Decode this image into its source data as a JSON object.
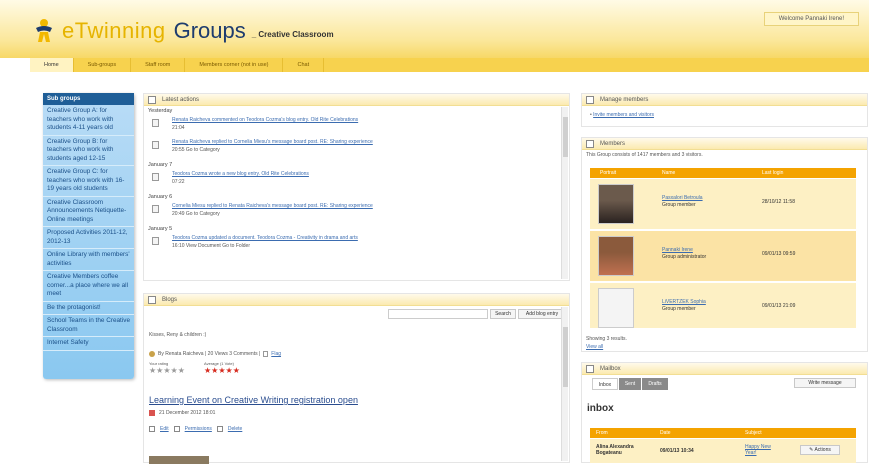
{
  "header": {
    "logo_text": "eTwinning",
    "logo_groups": "Groups",
    "logo_sub": "_ Creative Classroom",
    "welcome": "Welcome Pannaki Irene!"
  },
  "nav": [
    "Home",
    "Sub-groups",
    "Staff room",
    "Members corner (not in use)",
    "Chat"
  ],
  "sidebar": {
    "heading": "Sub groups",
    "items": [
      "Creative Group A: for teachers who work with students 4-11 years old",
      "Creative Group B: for teachers who work with students aged 12-15",
      "Creative Group C: for teachers who work with 16-19 years old students",
      "Creative Classroom Announcements Netiquette-Online meetings",
      "Proposed Activities 2011-12, 2012-13",
      "Online Library with members' activities",
      "Creative Members coffee corner...a place where we all meet",
      "Be the protagonist!",
      "School Teams in the Creative Classroom",
      "Internet Safety"
    ]
  },
  "latest": {
    "title": "Latest actions",
    "groups": [
      {
        "day": "Yesterday",
        "acts": [
          {
            "line": "Renata Raicheva commented on Teodora Cozma's blog entry. Old Rite Celebrations",
            "sub": "21:04"
          },
          {
            "line": "Renata Raicheva replied to Cornelia Miesu's message board post. RE: Sharing experience",
            "sub": "20:55 Go to Category"
          }
        ]
      },
      {
        "day": "January 7",
        "acts": [
          {
            "line": "Teodora Cozma wrote a new blog entry. Old Rite Celebrations",
            "sub": "07:22"
          }
        ]
      },
      {
        "day": "January 6",
        "acts": [
          {
            "line": "Cornelia Miesu replied to Renata Raicheva's message board post. RE: Sharing experience",
            "sub": "20:49 Go to Category"
          }
        ]
      },
      {
        "day": "January 5",
        "acts": [
          {
            "line": "Teodora Cozma updated a document. Teodora Cozma - Creativity in drama and arts",
            "sub": "16:10 View Document Go to Folder"
          }
        ]
      }
    ]
  },
  "blogs": {
    "title": "Blogs",
    "search_btn": "Search",
    "add_btn": "Add blog entry",
    "greeting": "Kisses, Reny & children :)",
    "byline": "By Renata Raicheva | 20 Views 3 Comments |",
    "flag": "Flag",
    "your_rating": "Your rating",
    "average": "Average (1 Vote)",
    "entry_title": "Learning Event on Creative Writing registration open",
    "entry_date": "21 December 2012 18:01",
    "edit": "Edit",
    "permissions": "Permissions",
    "delete": "Delete"
  },
  "manage": {
    "title": "Manage members",
    "link": "Invite members and visitors"
  },
  "members": {
    "title": "Members",
    "summary": "This Group consists of 1417 members and 3 visitors.",
    "headers": [
      "Portrait",
      "Name",
      "Last login"
    ],
    "rows": [
      {
        "name": "Pasxalori Betroula",
        "role": "Group member",
        "date": "28/10/12 11:58"
      },
      {
        "name": "Pannaki Irene",
        "role": "Group administrator",
        "date": "09/01/13 09:59"
      },
      {
        "name": "LiVERTZEK Sophia",
        "role": "Group member",
        "date": "09/01/13 21:09"
      }
    ],
    "showing": "Showing 3 results.",
    "view_all": "View all"
  },
  "mailbox": {
    "title": "Mailbox",
    "tabs": [
      "Inbox",
      "Sent",
      "Drafts"
    ],
    "write": "Write message",
    "inbox_title": "inbox",
    "headers": [
      "From",
      "Date",
      "Subject"
    ],
    "row": {
      "from": "Alina Alexandra Bogateanu",
      "date": "09/01/13 10:34",
      "subject": "Happy New Year!",
      "actions": "Actions"
    }
  }
}
